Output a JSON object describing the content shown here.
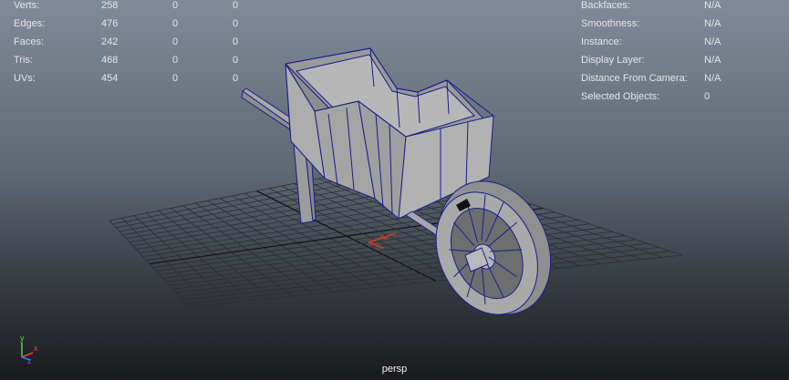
{
  "hud": {
    "poly_count": [
      {
        "label": "Verts:",
        "values": [
          "258",
          "0",
          "0"
        ]
      },
      {
        "label": "Edges:",
        "values": [
          "476",
          "0",
          "0"
        ]
      },
      {
        "label": "Faces:",
        "values": [
          "242",
          "0",
          "0"
        ]
      },
      {
        "label": "Tris:",
        "values": [
          "468",
          "0",
          "0"
        ]
      },
      {
        "label": "UVs:",
        "values": [
          "454",
          "0",
          "0"
        ]
      }
    ],
    "info": [
      {
        "label": "Backfaces:",
        "value": "N/A"
      },
      {
        "label": "Smoothness:",
        "value": "N/A"
      },
      {
        "label": "Instance:",
        "value": "N/A"
      },
      {
        "label": "Display Layer:",
        "value": "N/A"
      },
      {
        "label": "Distance From Camera:",
        "value": "N/A"
      },
      {
        "label": "Selected Objects:",
        "value": "0"
      }
    ]
  },
  "camera_name": "persp",
  "axis_labels": {
    "x": "x",
    "y": "y",
    "z": "z"
  },
  "colors": {
    "grid": "#2c2e31",
    "grid_axis": "#141414",
    "model_fill": "#a3a3a3",
    "wireframe": "#1b1c8c",
    "manipulator": "#d23c1e"
  }
}
